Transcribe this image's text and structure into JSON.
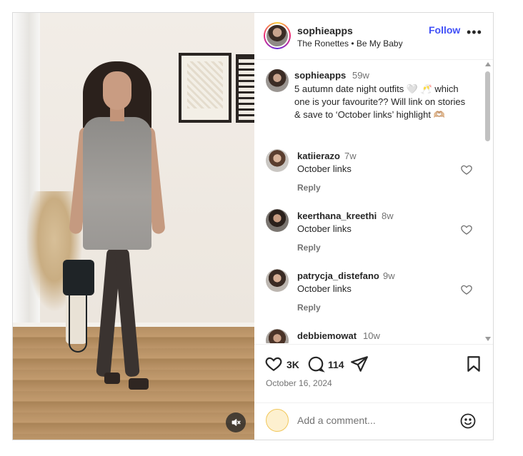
{
  "post": {
    "author": "sophieapps",
    "song": "The Ronettes • Be My Baby",
    "follow_label": "Follow",
    "more_label": "•••"
  },
  "caption": {
    "username": "sophieapps",
    "time": "59w",
    "text": "5 autumn date night outfits 🤍 🥂 which one is your favourite?? Will link on stories & save to ‘October links’ highlight 🫶🏼"
  },
  "comments": [
    {
      "username": "katiierazo",
      "time": "7w",
      "text": "October links",
      "reply_label": "Reply"
    },
    {
      "username": "keerthana_kreethi",
      "time": "8w",
      "text": "October links",
      "reply_label": "Reply"
    },
    {
      "username": "patrycja_distefano",
      "time": "9w",
      "text": "October links",
      "reply_label": "Reply"
    },
    {
      "username": "debbiemowat",
      "time": "10w"
    }
  ],
  "actions": {
    "likes": "3K",
    "comments": "114",
    "date": "October 16, 2024"
  },
  "add_comment": {
    "placeholder": "Add a comment..."
  },
  "icons": {
    "mute": "speaker-muted-icon",
    "like": "heart-icon",
    "comment": "comment-bubble-icon",
    "share": "paper-plane-icon",
    "save": "bookmark-icon",
    "emoji": "smiley-icon",
    "more": "ellipsis-icon"
  },
  "colors": {
    "follow": "#4150f7",
    "text": "#262626",
    "muted": "#737373",
    "border": "#dbdbdb"
  }
}
